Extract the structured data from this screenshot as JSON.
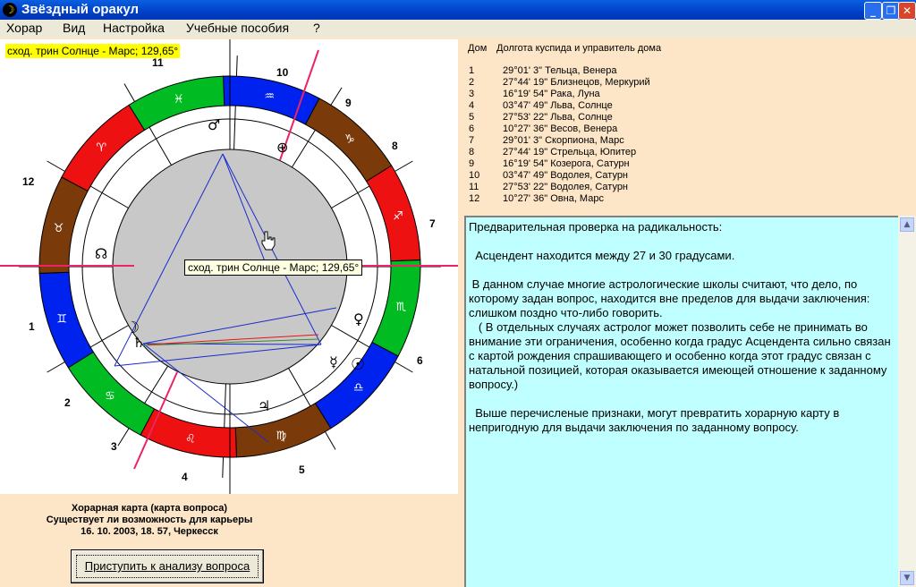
{
  "window": {
    "title": "Звёздный оракул",
    "icon": "app-icon"
  },
  "menu": [
    "Хорар",
    "Вид",
    "Настройка",
    "Учебные пособия",
    "?"
  ],
  "chart": {
    "tooltip_top": "сход. трин Солнце - Марс; 129,65°",
    "tooltip_center": "сход. трин Солнце - Марс; 129,65°",
    "house_numbers": [
      "1",
      "2",
      "3",
      "4",
      "5",
      "6",
      "7",
      "8",
      "9",
      "10",
      "11",
      "12"
    ],
    "colors": {
      "blue": "#0022ee",
      "green": "#00bb22",
      "red": "#ee1111",
      "brown": "#7a3a0a",
      "aspect_line": "#1a2acc",
      "axis_line": "#ee2266"
    }
  },
  "caption": {
    "line1": "Хорарная карта (карта вопроса)",
    "line2": "Существует ли возможность для карьеры",
    "line3": "16. 10. 2003,  18. 57, Черкесск"
  },
  "analyze_button": "Приступить к анализу вопроса",
  "houses": {
    "header_house": "Дом",
    "header_cusp": "Долгота куспида и управитель дома",
    "rows": [
      {
        "num": "1",
        "pos": "29°01' 3\" Тельца, Венера"
      },
      {
        "num": "2",
        "pos": "27°44' 19\" Близнецов, Меркурий"
      },
      {
        "num": "3",
        "pos": "16°19' 54\" Рака, Луна"
      },
      {
        "num": "4",
        "pos": "03°47' 49\" Льва, Солнце"
      },
      {
        "num": "5",
        "pos": "27°53' 22\" Льва, Солнце"
      },
      {
        "num": "6",
        "pos": "10°27' 36\" Весов, Венера"
      },
      {
        "num": "7",
        "pos": "29°01' 3\" Скорпиона, Марс"
      },
      {
        "num": "8",
        "pos": "27°44' 19\" Стрельца, Юпитер"
      },
      {
        "num": "9",
        "pos": "16°19' 54\" Козерога, Сатурн"
      },
      {
        "num": "10",
        "pos": "03°47' 49\" Водолея, Сатурн"
      },
      {
        "num": "11",
        "pos": "27°53' 22\" Водолея, Сатурн"
      },
      {
        "num": "12",
        "pos": "10°27' 36\" Овна, Марс"
      }
    ]
  },
  "analysis": {
    "p1": "Предварительная проверка на радикальность:",
    "p2": "  Асцендент находится между 27 и 30 градусами.",
    "p3": " В данном случае многие астрологические школы считают, что дело, по которому задан вопрос, находится вне пределов для выдачи заключения: слишком поздно что-либо говорить.\n   ( В отдельных случаях астролог может позволить себе не принимать во внимание эти ограничения, особенно когда градус Асцендента сильно связан с картой рождения спрашивающего и особенно когда этот градус связан с натальной позицией, которая оказывается имеющей отношение к заданному вопросу.)",
    "p4": "  Выше перечисленые признаки, могут превратить хорарную карту в непригодную для выдачи заключения по заданному вопросу."
  }
}
